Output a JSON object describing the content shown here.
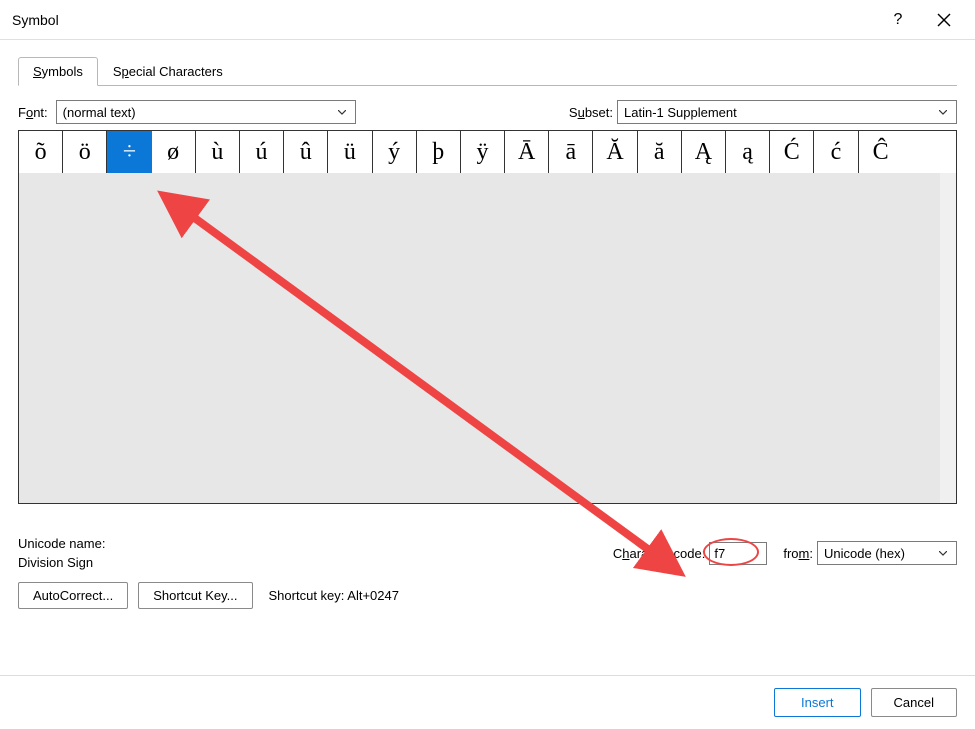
{
  "window": {
    "title": "Symbol",
    "help_glyph": "?",
    "close_glyph": "✕"
  },
  "tabs": {
    "symbols": "Symbols",
    "special": "Special Characters"
  },
  "font": {
    "label_pre": "F",
    "label_ul": "o",
    "label_post": "nt:",
    "value": "(normal text)"
  },
  "subset": {
    "label_pre": "S",
    "label_ul": "u",
    "label_post": "bset:",
    "value": "Latin-1 Supplement"
  },
  "symbols": {
    "row": [
      "õ",
      "ö",
      "÷",
      "ø",
      "ù",
      "ú",
      "û",
      "ü",
      "ý",
      "þ",
      "ÿ",
      "Ā",
      "ā",
      "Ă",
      "ă",
      "Ą",
      "ą",
      "Ć",
      "ć",
      "Ĉ"
    ],
    "selected_index": 2
  },
  "unicode_name": {
    "label": "Unicode name:",
    "value": "Division Sign"
  },
  "charcode": {
    "label_pre": "C",
    "label_ul": "h",
    "label_post": "aracter code:",
    "value": "f7"
  },
  "from": {
    "label_pre": "fro",
    "label_ul": "m",
    "label_post": ":",
    "value": "Unicode (hex)"
  },
  "buttons": {
    "autocorrect": "AutoCorrect...",
    "shortcutkey": "Shortcut Key...",
    "shortcut_text": "Shortcut key: Alt+0247",
    "insert": "Insert",
    "cancel": "Cancel"
  },
  "annotation": {
    "arrow_color": "#ef4444"
  }
}
